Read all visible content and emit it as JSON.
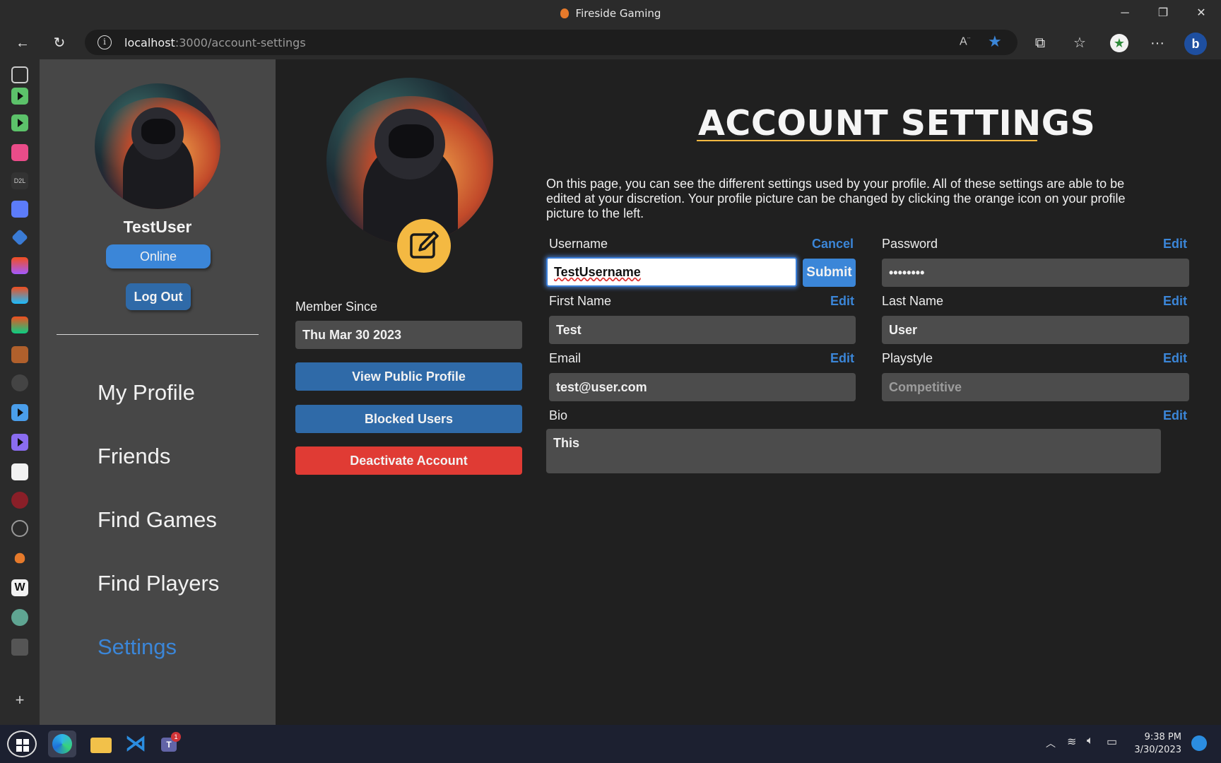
{
  "window": {
    "title": "Fireside Gaming"
  },
  "browser": {
    "url_host": "localhost",
    "url_path": ":3000/account-settings"
  },
  "sidebar": {
    "username": "TestUser",
    "status": "Online",
    "logout_label": "Log Out",
    "nav": [
      {
        "label": "My Profile"
      },
      {
        "label": "Friends"
      },
      {
        "label": "Find Games"
      },
      {
        "label": "Find Players"
      },
      {
        "label": "Settings",
        "active": true
      }
    ]
  },
  "profile": {
    "member_since_label": "Member Since",
    "member_since_value": "Thu Mar 30 2023",
    "view_public_label": "View Public Profile",
    "blocked_users_label": "Blocked Users",
    "deactivate_label": "Deactivate Account"
  },
  "settings": {
    "title": "ACCOUNT SETTINGS",
    "intro": "On this page, you can see the different settings used by your profile. All of these settings are able to be edited at your discretion. Your profile picture can be changed by clicking the orange icon on your profile picture to the left.",
    "username_label": "Username",
    "cancel_label": "Cancel",
    "username_value": "TestUsername",
    "submit_label": "Submit",
    "password_label": "Password",
    "password_value": "••••••••",
    "first_name_label": "First Name",
    "first_name_value": "Test",
    "last_name_label": "Last Name",
    "last_name_value": "User",
    "email_label": "Email",
    "email_value": "test@user.com",
    "playstyle_label": "Playstyle",
    "playstyle_placeholder": "Competitive",
    "bio_label": "Bio",
    "bio_value": "This",
    "edit_label": "Edit"
  },
  "taskbar": {
    "time": "9:38 PM",
    "date": "3/30/2023",
    "teams_badge": "1"
  },
  "colors": {
    "accent_blue": "#3b86d8",
    "button_blue": "#2f6aa8",
    "danger_red": "#e03b34",
    "edit_badge": "#f4b942"
  }
}
